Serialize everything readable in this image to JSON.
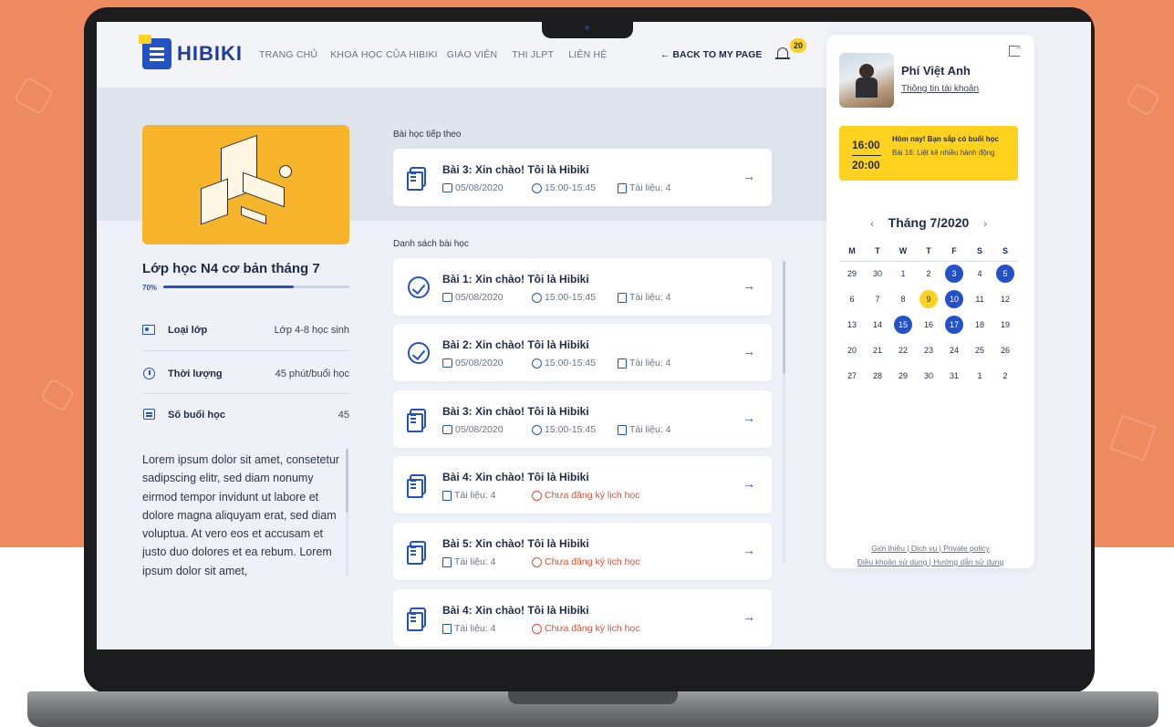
{
  "header": {
    "logo": "HIBIKI",
    "nav": [
      "TRANG CHỦ",
      "KHOÁ HỌC CỦA HIBIKI",
      "GIÁO VIÊN",
      "THI JLPT",
      "LIÊN HỆ"
    ],
    "back_link": "← BACK TO MY PAGE",
    "notification_count": "20"
  },
  "course": {
    "title": "Lớp học N4 cơ bản tháng 7",
    "progress_label": "70%",
    "progress": 0.7,
    "info": [
      {
        "label": "Loại lớp",
        "value": "Lớp 4-8 học sinh",
        "icon": "classroom-icon"
      },
      {
        "label": "Thời lượng",
        "value": "45 phút/buổi học",
        "icon": "clock-icon"
      },
      {
        "label": "Số buổi học",
        "value": "45",
        "icon": "document-icon"
      }
    ],
    "description": "Lorem ipsum dolor sit amet, consetetur sadipscing elitr, sed diam nonumy eirmod tempor invidunt ut labore et dolore magna aliquyam erat, sed diam voluptua. At vero eos et accusam et justo duo dolores et ea rebum. Lorem ipsum dolor sit amet,"
  },
  "next_lesson": {
    "section_label": "Bài học tiếp theo",
    "title": "Bài 3: Xin chào! Tôi là Hibiki",
    "date": "05/08/2020",
    "time": "15:00-15:45",
    "docs": "Tài liệu: 4"
  },
  "lesson_list": {
    "section_label": "Danh sách bài học",
    "items": [
      {
        "title": "Bài 1: Xin chào! Tôi là Hibiki",
        "date": "05/08/2020",
        "time": "15:00-15:45",
        "docs": "Tài liệu: 4",
        "status": "done"
      },
      {
        "title": "Bài 2: Xin chào! Tôi là Hibiki",
        "date": "05/08/2020",
        "time": "15:00-15:45",
        "docs": "Tài liệu: 4",
        "status": "done"
      },
      {
        "title": "Bài 3: Xin chào! Tôi là Hibiki",
        "date": "05/08/2020",
        "time": "15:00-15:45",
        "docs": "Tài liệu: 4",
        "status": "scheduled"
      },
      {
        "title": "Bài 4: Xin chào! Tôi là Hibiki",
        "docs": "Tài liệu: 4",
        "warning": "Chưa đăng ký lịch học",
        "status": "unregistered"
      },
      {
        "title": "Bài 5: Xin chào! Tôi là Hibiki",
        "docs": "Tài liệu: 4",
        "warning": "Chưa đăng ký lịch học",
        "status": "unregistered"
      },
      {
        "title": "Bài 4: Xin chào! Tôi là Hibiki",
        "docs": "Tài liệu: 4",
        "warning": "Chưa đăng ký lịch học",
        "status": "unregistered"
      }
    ]
  },
  "user": {
    "name": "Phí Việt Anh",
    "account_link": "Thông tin tài khoản"
  },
  "today": {
    "start": "16:00",
    "end": "20:00",
    "headline": "Hôm nay! Bạn sắp có buổi học",
    "detail": "Bài 16: Liệt kê nhiều hành động"
  },
  "calendar": {
    "title": "Tháng 7/2020",
    "weekdays": [
      "M",
      "T",
      "W",
      "T",
      "F",
      "S",
      "S"
    ],
    "days": [
      {
        "d": "29",
        "m": ""
      },
      {
        "d": "30",
        "m": ""
      },
      {
        "d": "1",
        "m": ""
      },
      {
        "d": "2",
        "m": ""
      },
      {
        "d": "3",
        "m": "blue"
      },
      {
        "d": "4",
        "m": ""
      },
      {
        "d": "5",
        "m": "blue"
      },
      {
        "d": "6",
        "m": ""
      },
      {
        "d": "7",
        "m": ""
      },
      {
        "d": "8",
        "m": ""
      },
      {
        "d": "9",
        "m": "yellow"
      },
      {
        "d": "10",
        "m": "blue"
      },
      {
        "d": "11",
        "m": ""
      },
      {
        "d": "12",
        "m": ""
      },
      {
        "d": "13",
        "m": ""
      },
      {
        "d": "14",
        "m": ""
      },
      {
        "d": "15",
        "m": "blue"
      },
      {
        "d": "16",
        "m": ""
      },
      {
        "d": "17",
        "m": "blue"
      },
      {
        "d": "18",
        "m": ""
      },
      {
        "d": "19",
        "m": ""
      },
      {
        "d": "20",
        "m": ""
      },
      {
        "d": "21",
        "m": ""
      },
      {
        "d": "22",
        "m": ""
      },
      {
        "d": "23",
        "m": ""
      },
      {
        "d": "24",
        "m": ""
      },
      {
        "d": "25",
        "m": ""
      },
      {
        "d": "26",
        "m": ""
      },
      {
        "d": "27",
        "m": ""
      },
      {
        "d": "28",
        "m": ""
      },
      {
        "d": "29",
        "m": ""
      },
      {
        "d": "30",
        "m": ""
      },
      {
        "d": "31",
        "m": ""
      },
      {
        "d": "1",
        "m": ""
      },
      {
        "d": "2",
        "m": ""
      }
    ]
  },
  "footer": {
    "line1": "Giới thiệu | Dịch vụ | Private policy",
    "line2": "Điều khoản sử dụng | Hướng dẫn sử dụng"
  },
  "colors": {
    "background": "#ee8a5f",
    "primary": "#2352c7",
    "accent_yellow": "#ffd21f",
    "course_image": "#f8b52b",
    "warning": "#e64b2a"
  }
}
